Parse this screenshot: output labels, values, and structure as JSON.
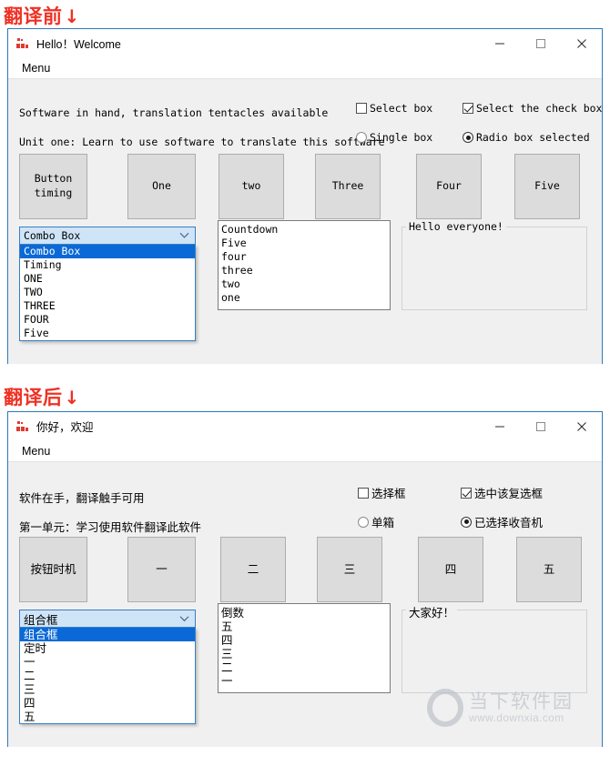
{
  "annotations": {
    "before_label": "翻译前",
    "after_label": "翻译后",
    "arrow": "↓"
  },
  "before_window": {
    "title": "Hello！Welcome",
    "icon": "app-icon",
    "menu": {
      "items": [
        "Menu"
      ]
    },
    "window_controls": {
      "minimize": "minimize-icon",
      "maximize": "maximize-icon",
      "close": "close-icon"
    },
    "labels": {
      "line1": "Software in hand, translation tentacles available",
      "line2": "Unit one: Learn to use software to translate this software"
    },
    "checkboxes": [
      {
        "label": "Select box",
        "checked": false
      },
      {
        "label": "Select the check box",
        "checked": true
      }
    ],
    "radios": [
      {
        "label": "Single box",
        "selected": false
      },
      {
        "label": "Radio box selected",
        "selected": true
      }
    ],
    "buttons": [
      {
        "label": "Button\ntiming"
      },
      {
        "label": "One"
      },
      {
        "label": "two"
      },
      {
        "label": "Three"
      },
      {
        "label": "Four"
      },
      {
        "label": "Five"
      }
    ],
    "combo": {
      "value": "Combo Box",
      "expanded": true,
      "options": [
        "Combo Box",
        "Timing",
        "ONE",
        "TWO",
        "THREE",
        "FOUR",
        "Five"
      ],
      "selected_index": 0
    },
    "listbox": {
      "items": [
        "Countdown",
        "Five",
        "four",
        "three",
        "two",
        "one"
      ]
    },
    "groupbox": {
      "title": "Hello everyone!"
    }
  },
  "after_window": {
    "title": "你好，欢迎",
    "icon": "app-icon",
    "menu": {
      "items": [
        "Menu"
      ]
    },
    "window_controls": {
      "minimize": "minimize-icon",
      "maximize": "maximize-icon",
      "close": "close-icon"
    },
    "labels": {
      "line1": "软件在手，翻译触手可用",
      "line2": "第一单元：学习使用软件翻译此软件"
    },
    "checkboxes": [
      {
        "label": "选择框",
        "checked": false
      },
      {
        "label": "选中该复选框",
        "checked": true
      }
    ],
    "radios": [
      {
        "label": "单箱",
        "selected": false
      },
      {
        "label": "已选择收音机",
        "selected": true
      }
    ],
    "buttons": [
      {
        "label": "按钮时机"
      },
      {
        "label": "一"
      },
      {
        "label": "二"
      },
      {
        "label": "三"
      },
      {
        "label": "四"
      },
      {
        "label": "五"
      }
    ],
    "combo": {
      "value": "组合框",
      "expanded": true,
      "options": [
        "组合框",
        "定时",
        "一",
        "二",
        "三",
        "四",
        "五"
      ],
      "selected_index": 0
    },
    "listbox": {
      "items": [
        "倒数",
        "五",
        "四",
        "三",
        "二",
        "一"
      ]
    },
    "groupbox": {
      "title": "大家好！"
    }
  },
  "watermark": {
    "brand": "当下软件园",
    "url": "www.downxia.com"
  },
  "colors": {
    "accent_red": "#ef3124",
    "window_border": "#2e7ab8",
    "client_bg": "#f0f0f0",
    "button_face": "#dcdcdc",
    "combo_head": "#cfe4f7",
    "combo_selected": "#0a69d6"
  }
}
